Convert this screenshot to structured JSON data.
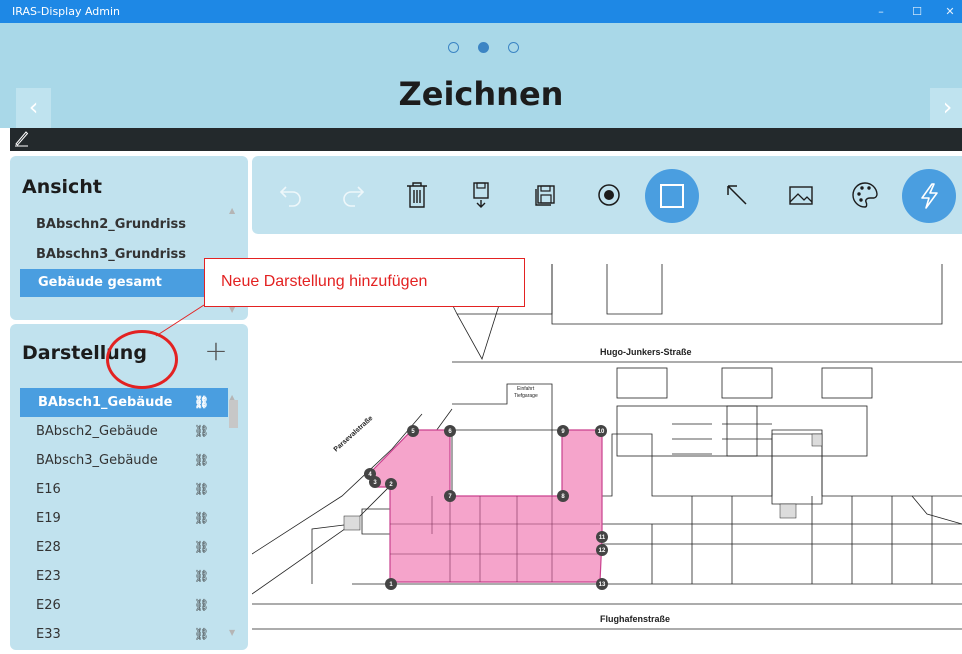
{
  "window": {
    "title": "IRAS-Display Admin",
    "minimize": "–",
    "maximize": "☐",
    "close": "✕"
  },
  "header": {
    "title": "Zeichnen",
    "prev": "‹",
    "next": "›",
    "page_dots": 3,
    "active_dot": 2
  },
  "ansicht": {
    "title": "Ansicht",
    "items": [
      {
        "label": "BAbschn2_Grundriss",
        "selected": false
      },
      {
        "label": "BAbschn3_Grundriss",
        "selected": false
      },
      {
        "label": "Gebäude gesamt",
        "selected": true
      }
    ]
  },
  "darstellung": {
    "title": "Darstellung",
    "add": "+",
    "items": [
      {
        "label": "BAbsch1_Gebäude",
        "selected": true
      },
      {
        "label": "BAbsch2_Gebäude",
        "selected": false
      },
      {
        "label": "BAbsch3_Gebäude",
        "selected": false
      },
      {
        "label": "E16",
        "selected": false
      },
      {
        "label": "E19",
        "selected": false
      },
      {
        "label": "E28",
        "selected": false
      },
      {
        "label": "E23",
        "selected": false
      },
      {
        "label": "E26",
        "selected": false
      },
      {
        "label": "E33",
        "selected": false
      }
    ]
  },
  "toolbar": {
    "tools": [
      "undo-icon",
      "redo-icon",
      "trash-icon",
      "save-down-icon",
      "save-all-icon",
      "record-icon",
      "rectangle-icon",
      "arrow-icon",
      "image-icon",
      "palette-icon",
      "flash-icon"
    ],
    "active": "rectangle-icon"
  },
  "callout": {
    "text": "Neue Darstellung hinzufügen"
  },
  "map": {
    "street_top": "Hugo-Junkers-Straße",
    "street_bottom": "Flughafenstraße",
    "street_left": "Parsevalstraße",
    "entry_label_1": "Einfahrt",
    "entry_label_2": "Tiefgarage",
    "highlight_color": "#f5a4cb",
    "points": [
      "1",
      "2",
      "3",
      "4",
      "5",
      "6",
      "7",
      "8",
      "9",
      "10",
      "11",
      "12",
      "13"
    ]
  },
  "colors": {
    "accent": "#4a9ee0",
    "header": "#a9d8e8",
    "panel": "#c1e2ee",
    "titlebar": "#1e88e5",
    "annotation": "#e32222"
  }
}
